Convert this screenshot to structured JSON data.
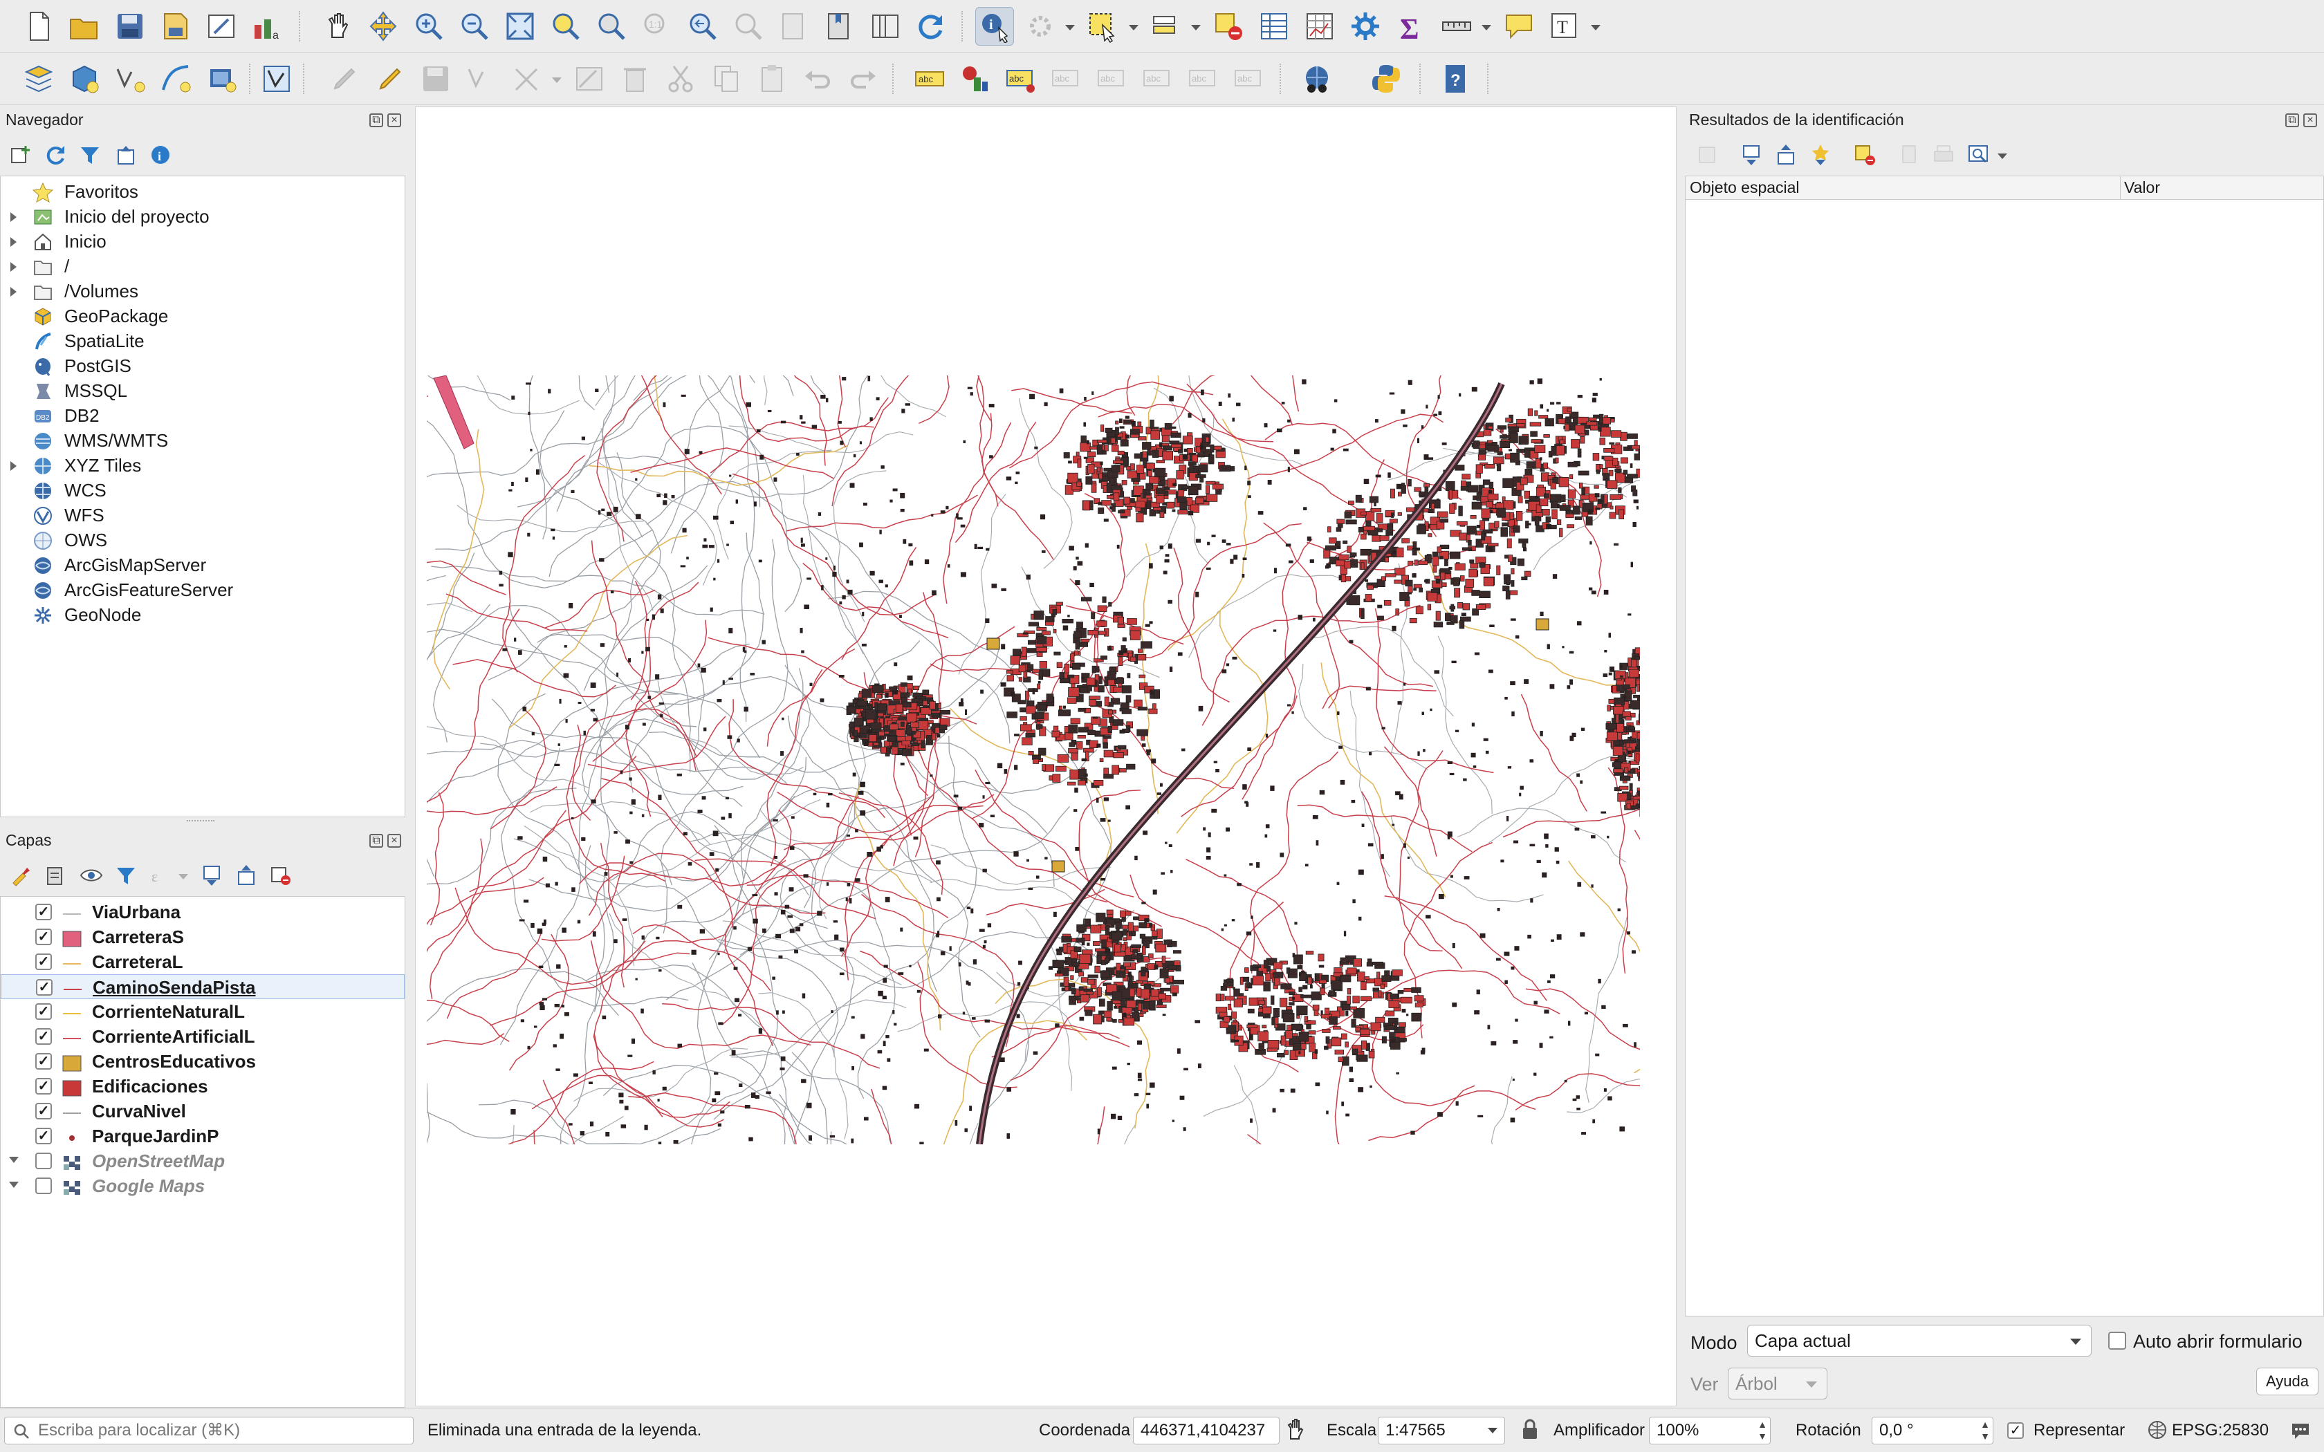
{
  "app": {
    "crs": "EPSG:25830"
  },
  "toolbar_row1": {
    "icons": [
      "new-project-icon",
      "open-project-icon",
      "save-project-icon",
      "save-as-icon",
      "print-layout-icon",
      "style-manager-icon",
      "pan-icon",
      "pan-to-selection-icon",
      "zoom-in-icon",
      "zoom-out-icon",
      "zoom-full-icon",
      "zoom-to-selection-icon",
      "zoom-to-layer-icon",
      "zoom-native-icon",
      "zoom-last-icon",
      "zoom-next-icon",
      "new-bookmark-icon",
      "show-bookmarks-icon",
      "temporal-icon",
      "refresh-icon",
      "identify-icon",
      "actions-icon",
      "select-features-icon",
      "select-by-value-icon",
      "deselect-icon",
      "attribute-table-icon",
      "field-calculator-icon",
      "processing-toolbox-icon",
      "statistics-icon",
      "measure-icon",
      "map-tips-icon",
      "text-annotation-icon"
    ]
  },
  "toolbar_row2": {
    "icons": [
      "data-source-manager-icon",
      "new-geopackage-icon",
      "digitize-vertex-icon",
      "digitize-curve-icon",
      "virtual-layer-icon",
      "vertex-editor-icon",
      "edits-icon",
      "toggle-editing-icon",
      "save-edits-icon",
      "add-feature-icon",
      "vertex-tool-icon",
      "modify-attributes-icon",
      "delete-selected-icon",
      "cut-features-icon",
      "copy-features-icon",
      "paste-features-icon",
      "undo-icon",
      "redo-icon",
      "label-icon",
      "diagram-icon",
      "highlight-label-icon",
      "pin-labels-icon",
      "show-hide-labels-icon",
      "move-label-icon",
      "rotate-label-icon",
      "change-label-icon",
      "plugin-globe-icon",
      "python-console-icon",
      "help-icon"
    ]
  },
  "browser": {
    "title": "Navegador",
    "items": [
      {
        "label": "Favoritos",
        "icon": "star-icon",
        "expandable": false
      },
      {
        "label": "Inicio del proyecto",
        "icon": "project-home-icon",
        "expandable": true
      },
      {
        "label": "Inicio",
        "icon": "home-icon",
        "expandable": true
      },
      {
        "label": "/",
        "icon": "folder-icon",
        "expandable": true
      },
      {
        "label": "/Volumes",
        "icon": "folder-icon",
        "expandable": true
      },
      {
        "label": "GeoPackage",
        "icon": "geopackage-icon",
        "expandable": false
      },
      {
        "label": "SpatiaLite",
        "icon": "spatialite-icon",
        "expandable": false
      },
      {
        "label": "PostGIS",
        "icon": "postgis-icon",
        "expandable": false
      },
      {
        "label": "MSSQL",
        "icon": "mssql-icon",
        "expandable": false
      },
      {
        "label": "DB2",
        "icon": "db2-icon",
        "expandable": false
      },
      {
        "label": "WMS/WMTS",
        "icon": "wms-icon",
        "expandable": false
      },
      {
        "label": "XYZ Tiles",
        "icon": "xyz-icon",
        "expandable": true
      },
      {
        "label": "WCS",
        "icon": "wcs-icon",
        "expandable": false
      },
      {
        "label": "WFS",
        "icon": "wfs-icon",
        "expandable": false
      },
      {
        "label": "OWS",
        "icon": "ows-icon",
        "expandable": false
      },
      {
        "label": "ArcGisMapServer",
        "icon": "arcgis-icon",
        "expandable": false
      },
      {
        "label": "ArcGisFeatureServer",
        "icon": "arcgis-icon",
        "expandable": false
      },
      {
        "label": "GeoNode",
        "icon": "geonode-icon",
        "expandable": false
      }
    ]
  },
  "layers": {
    "title": "Capas",
    "items": [
      {
        "label": "ViaUrbana",
        "checked": true,
        "symbol": "line",
        "color": "#b8b8b8",
        "selected": false
      },
      {
        "label": "CarreteraS",
        "checked": true,
        "symbol": "fill",
        "color": "#e0607e",
        "selected": false
      },
      {
        "label": "CarreteraL",
        "checked": true,
        "symbol": "line",
        "color": "#e8b860",
        "selected": false
      },
      {
        "label": "CaminoSendaPista",
        "checked": true,
        "symbol": "line",
        "color": "#c8404c",
        "selected": true
      },
      {
        "label": "CorrienteNaturalL",
        "checked": true,
        "symbol": "line",
        "color": "#e8c040",
        "selected": false
      },
      {
        "label": "CorrienteArtificialL",
        "checked": true,
        "symbol": "line",
        "color": "#d05060",
        "selected": false
      },
      {
        "label": "CentrosEducativos",
        "checked": true,
        "symbol": "fill",
        "color": "#d8a838",
        "selected": false
      },
      {
        "label": "Edificaciones",
        "checked": true,
        "symbol": "fill",
        "color": "#c83838",
        "selected": false
      },
      {
        "label": "CurvaNivel",
        "checked": true,
        "symbol": "line",
        "color": "#a0a0a0",
        "selected": false
      },
      {
        "label": "ParqueJardinP",
        "checked": true,
        "symbol": "point",
        "color": "#a03030",
        "selected": false
      },
      {
        "label": "OpenStreetMap",
        "checked": false,
        "symbol": "tiles",
        "color": "#4a5a7a",
        "selected": false
      },
      {
        "label": "Google Maps",
        "checked": false,
        "symbol": "tiles",
        "color": "#4a5a7a",
        "selected": false
      }
    ]
  },
  "identify": {
    "title": "Resultados de la identificación",
    "col_feature": "Objeto espacial",
    "col_value": "Valor",
    "mode_label": "Modo",
    "mode_value": "Capa actual",
    "auto_open_label": "Auto abrir formulario",
    "view_label": "Ver",
    "view_value": "Árbol",
    "help_label": "Ayuda"
  },
  "statusbar": {
    "locator_placeholder": "Escriba para localizar (⌘K)",
    "message": "Eliminada una entrada de la leyenda.",
    "coord_label": "Coordenada",
    "coord_value": "446371,4104237",
    "scale_label": "Escala",
    "scale_value": "1:47565",
    "magnifier_label": "Amplificador",
    "magnifier_value": "100%",
    "rotation_label": "Rotación",
    "rotation_value": "0,0 °",
    "render_label": "Representar",
    "crs_value": "EPSG:25830"
  }
}
